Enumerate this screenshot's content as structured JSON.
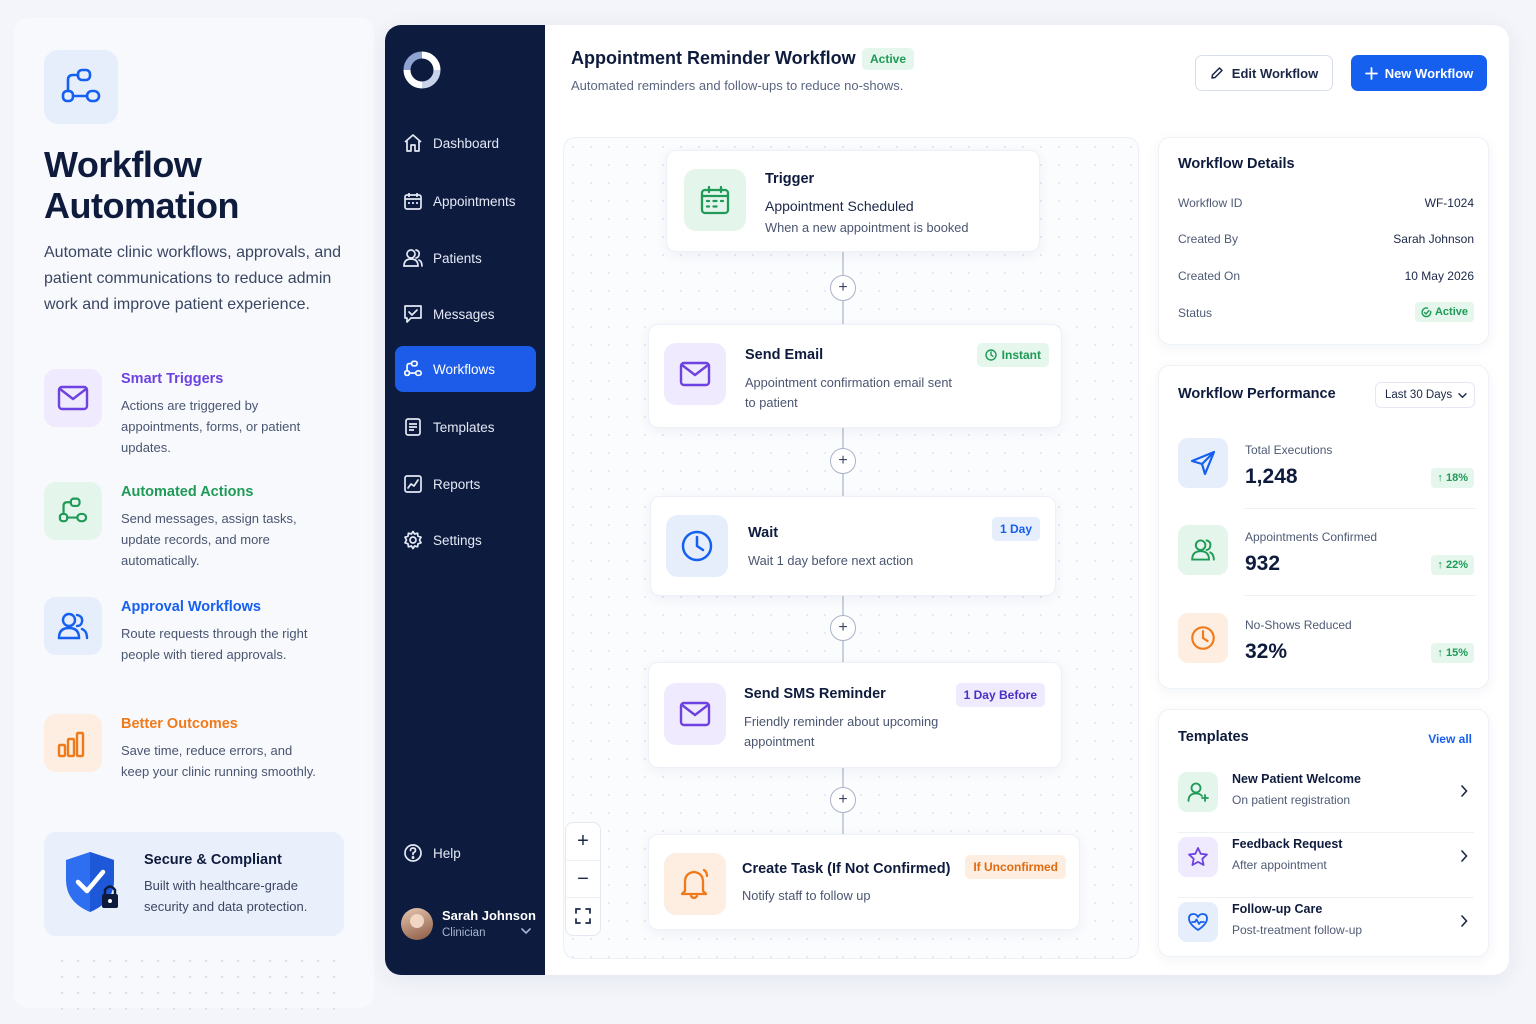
{
  "promo": {
    "title": "Workflow Automation",
    "lead": "Automate clinic workflows, approvals, and patient communications to reduce admin work and improve patient experience.",
    "features": [
      {
        "title": "Smart Triggers",
        "desc": "Actions are triggered by appointments, forms, or patient updates.",
        "color": "#6d42e0",
        "icon": "mail-icon"
      },
      {
        "title": "Automated Actions",
        "desc": "Send messages, assign tasks, update records, and more automatically.",
        "color": "#1f9a57",
        "icon": "workflow-icon"
      },
      {
        "title": "Approval Workflows",
        "desc": "Route requests through the right people with tiered approvals.",
        "color": "#1660f0",
        "icon": "users-icon"
      },
      {
        "title": "Better Outcomes",
        "desc": "Save time, reduce errors, and keep your clinic running smoothly.",
        "color": "#f07a1a",
        "icon": "bar-chart-icon"
      }
    ],
    "secure": {
      "title": "Secure & Compliant",
      "desc": "Built with healthcare-grade security and data protection."
    }
  },
  "sidebar": {
    "items": [
      {
        "label": "Dashboard",
        "icon": "home-icon"
      },
      {
        "label": "Appointments",
        "icon": "calendar-icon"
      },
      {
        "label": "Patients",
        "icon": "users-icon"
      },
      {
        "label": "Messages",
        "icon": "message-icon"
      },
      {
        "label": "Workflows",
        "icon": "workflow-icon",
        "active": true
      },
      {
        "label": "Templates",
        "icon": "document-icon"
      },
      {
        "label": "Reports",
        "icon": "chart-icon"
      },
      {
        "label": "Settings",
        "icon": "gear-icon"
      }
    ],
    "help": "Help",
    "user": {
      "name": "Sarah Johnson",
      "role": "Clinician"
    }
  },
  "header": {
    "title": "Appointment Reminder Workflow",
    "badge": "Active",
    "subtitle": "Automated reminders and follow-ups to reduce no-shows.",
    "edit_label": "Edit Workflow",
    "new_label": "New Workflow"
  },
  "flow": {
    "trigger": {
      "title": "Trigger",
      "subtitle": "Appointment Scheduled",
      "desc": "When a new appointment is booked"
    },
    "steps": [
      {
        "title": "Send Email",
        "desc": "Appointment confirmation email sent to patient",
        "tag": "Instant"
      },
      {
        "title": "Wait",
        "desc": "Wait 1 day before next action",
        "tag": "1 Day"
      },
      {
        "title": "Send SMS Reminder",
        "desc": "Friendly reminder about upcoming appointment",
        "tag": "1 Day Before"
      },
      {
        "title": "Create Task (If Not Confirmed)",
        "desc": "Notify staff to follow up",
        "tag": "If Unconfirmed"
      }
    ]
  },
  "details": {
    "title": "Workflow Details",
    "rows": [
      {
        "label": "Workflow ID",
        "value": "WF-1024"
      },
      {
        "label": "Created By",
        "value": "Sarah Johnson"
      },
      {
        "label": "Created On",
        "value": "10 May 2026"
      }
    ],
    "status_label": "Status",
    "status_value": "Active"
  },
  "performance": {
    "title": "Workflow Performance",
    "range": "Last 30 Days",
    "metrics": [
      {
        "label": "Total Executions",
        "value": "1,248",
        "delta": "↑ 18%"
      },
      {
        "label": "Appointments Confirmed",
        "value": "932",
        "delta": "↑ 22%"
      },
      {
        "label": "No-Shows Reduced",
        "value": "32%",
        "delta": "↑ 15%"
      }
    ]
  },
  "templates": {
    "title": "Templates",
    "view_all": "View all",
    "items": [
      {
        "title": "New Patient Welcome",
        "subtitle": "On patient registration"
      },
      {
        "title": "Feedback Request",
        "subtitle": "After appointment"
      },
      {
        "title": "Follow-up Care",
        "subtitle": "Post-treatment follow-up"
      }
    ]
  }
}
